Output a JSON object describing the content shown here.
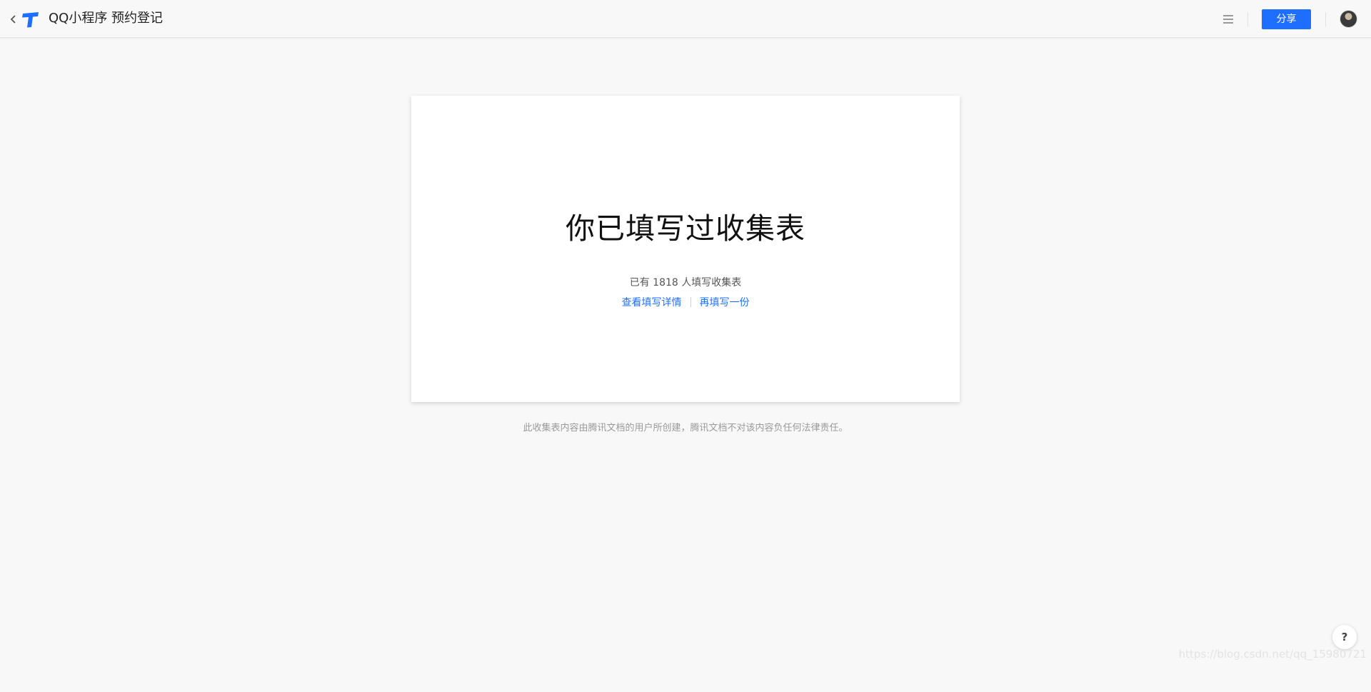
{
  "header": {
    "title": "QQ小程序 预约登记",
    "share_label": "分享",
    "icons": {
      "back": "chevron-left-icon",
      "logo": "tencent-docs-logo",
      "menu": "hamburger-menu-icon",
      "avatar": "user-avatar"
    }
  },
  "card": {
    "heading": "你已填写过收集表",
    "count_text": "已有 1818 人填写收集表",
    "view_details_label": "查看填写详情",
    "fill_again_label": "再填写一份"
  },
  "footer": {
    "disclaimer": "此收集表内容由腾讯文档的用户所创建，腾讯文档不对该内容负任何法律责任。"
  },
  "help": {
    "label": "?"
  },
  "watermark": {
    "text": "https://blog.csdn.net/qq_15980721"
  },
  "colors": {
    "accent": "#1e6fff",
    "background": "#f8f8f8",
    "card": "#ffffff"
  }
}
